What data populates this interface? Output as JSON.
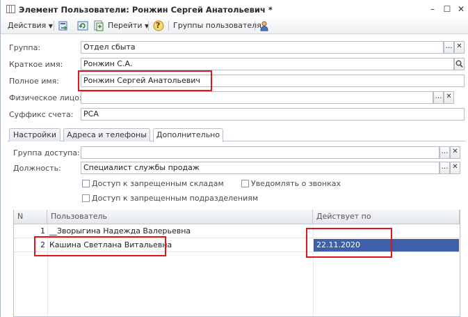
{
  "window": {
    "title": "Элемент Пользователи: Ронжин Сергей Анатольевич *",
    "minimize": "–",
    "maximize": "☐",
    "close": "✕"
  },
  "toolbar": {
    "actions_label": "Действия",
    "goto_label": "Перейти",
    "help_label": "?",
    "user_groups_label": "Группы пользователя"
  },
  "form": {
    "group": {
      "label": "Группа:",
      "value": "Отдел сбыта"
    },
    "short_name": {
      "label": "Краткое имя:",
      "value": "Ронжин С.А."
    },
    "full_name": {
      "label": "Полное имя:",
      "value": "Ронжин Сергей Анатольевич"
    },
    "physical_person": {
      "label": "Физическое лицо:",
      "value": ""
    },
    "account_suffix": {
      "label": "Суффикс счета:",
      "value": "РСА"
    }
  },
  "tabs": [
    {
      "label": "Настройки"
    },
    {
      "label": "Адреса и телефоны"
    },
    {
      "label": "Дополнительно"
    }
  ],
  "extra": {
    "access_group": {
      "label": "Группа доступа:",
      "value": ""
    },
    "position": {
      "label": "Должность:",
      "value": "Специалист службы продаж"
    },
    "checkboxes": {
      "restricted_warehouses": {
        "label": "Доступ к запрещенным складам",
        "checked": false
      },
      "notify_calls": {
        "label": "Уведомлять о звонках",
        "checked": false
      },
      "restricted_departments": {
        "label": "Доступ к запрещенным подразделениям",
        "checked": false
      }
    }
  },
  "grid": {
    "columns": [
      "N",
      "Пользователь",
      "Действует по"
    ],
    "rows": [
      {
        "n": "1",
        "user": "__Зворыгина Надежда Валерьевна",
        "until": ""
      },
      {
        "n": "2",
        "user": "Кашина Светлана Витальевна",
        "until": "22.11.2020"
      }
    ]
  },
  "colors": {
    "highlight_box": "#e0161b",
    "selected_cell": "#3f5fa8"
  },
  "icons": [
    "app-icon",
    "refresh-icon",
    "copy-icon",
    "add-icon",
    "help-icon",
    "user-icon",
    "ellipsis-icon",
    "clear-icon",
    "search-icon"
  ]
}
